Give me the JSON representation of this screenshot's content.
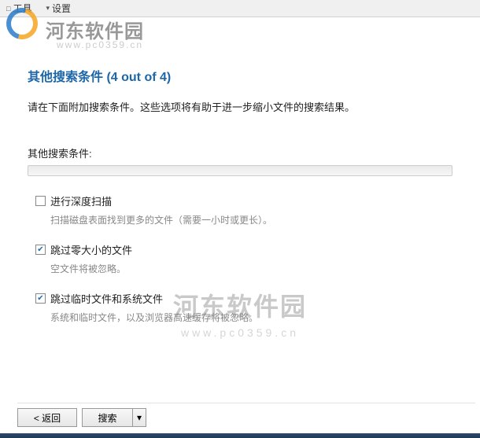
{
  "menubar": {
    "tools": "工具",
    "settings": "设置"
  },
  "watermark": {
    "site_name": "河东软件园",
    "site_url": "www.pc0359.cn"
  },
  "page": {
    "title": "其他搜索条件 (4 out of 4)",
    "subtitle": "请在下面附加搜索条件。这些选项将有助于进一步缩小文件的搜索结果。",
    "section_label": "其他搜索条件:"
  },
  "options": [
    {
      "checked": false,
      "label": "进行深度扫描",
      "description": "扫描磁盘表面找到更多的文件（需要一小时或更长）。"
    },
    {
      "checked": true,
      "label": "跳过零大小的文件",
      "description": "空文件将被忽略。"
    },
    {
      "checked": true,
      "label": "跳过临时文件和系统文件",
      "description": "系统和临时文件，以及浏览器高速缓存将被忽略。"
    }
  ],
  "buttons": {
    "back": "< 返回",
    "search": "搜索"
  }
}
